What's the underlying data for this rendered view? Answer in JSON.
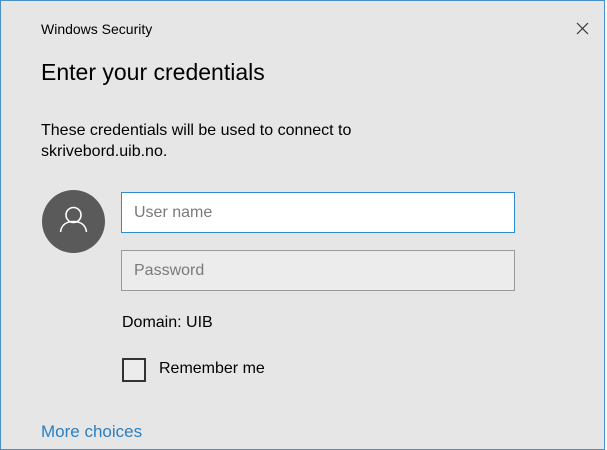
{
  "window": {
    "title": "Windows Security"
  },
  "dialog": {
    "heading": "Enter your credentials",
    "description_line1": "These credentials will be used to connect to",
    "description_line2": "skrivebord.uib.no."
  },
  "form": {
    "username": {
      "value": "",
      "placeholder": "User name"
    },
    "password": {
      "value": "",
      "placeholder": "Password"
    },
    "domain_text": "Domain: UIB",
    "remember_label": "Remember me",
    "remember_checked": false
  },
  "links": {
    "more_choices": "More choices"
  },
  "icons": {
    "close": "close-icon",
    "avatar": "user-avatar-icon"
  },
  "colors": {
    "accent": "#2f8bd1",
    "link": "#2b7fc3",
    "background": "#e6e6e6"
  }
}
